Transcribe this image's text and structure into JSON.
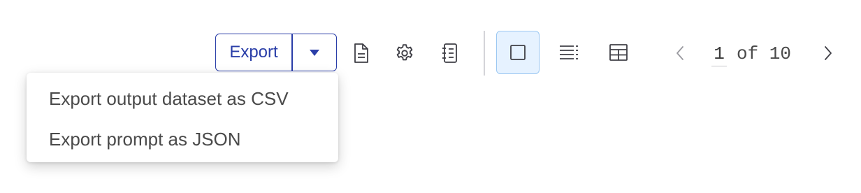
{
  "toolbar": {
    "export_label": "Export",
    "export_caret_icon": "caret-down-icon",
    "icons": {
      "document": "document-icon",
      "settings": "gear-icon",
      "notebook": "notebook-icon",
      "single_view": "square-icon",
      "list_view": "list-icon",
      "table_view": "table-icon",
      "prev": "chevron-left-icon",
      "next": "chevron-right-icon"
    },
    "active_view": "single"
  },
  "pagination": {
    "current": "1",
    "of_text": "of 10"
  },
  "export_menu": {
    "items": [
      {
        "label": "Export output dataset as CSV"
      },
      {
        "label": "Export prompt as JSON"
      }
    ]
  },
  "colors": {
    "accent": "#2a3ea8",
    "active_bg": "#e6f2ff",
    "active_border": "#9cc8f2",
    "icon": "#3f3f46"
  }
}
